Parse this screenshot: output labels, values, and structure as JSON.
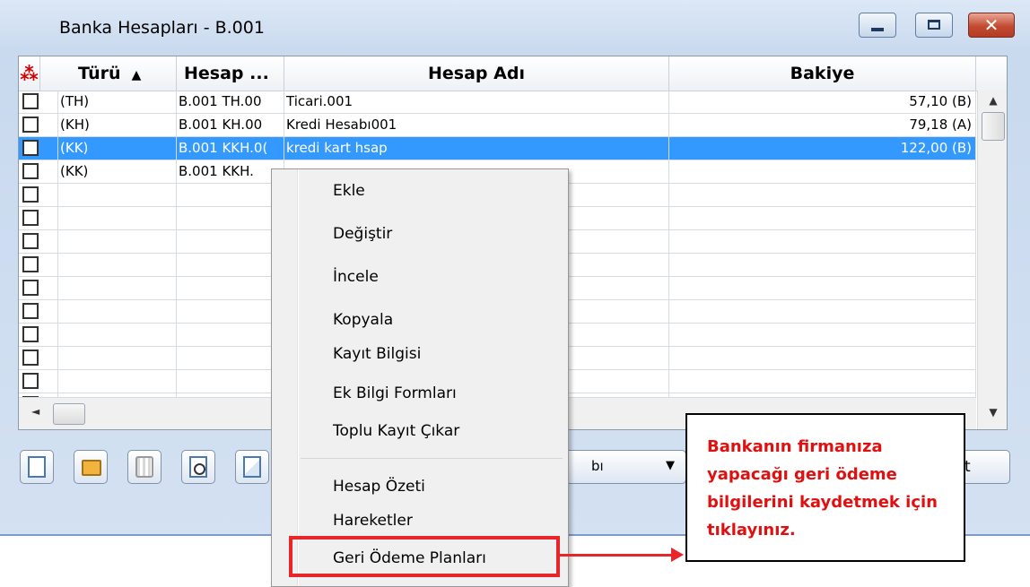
{
  "window": {
    "title": "Banka Hesapları - B.001",
    "controls": {
      "minimize": "minimize-icon",
      "maximize": "maximize-icon",
      "close": "✕"
    }
  },
  "grid": {
    "columns": [
      {
        "key": "select_all",
        "label": "⁂"
      },
      {
        "key": "turu",
        "label": "Türü",
        "sort": "▲"
      },
      {
        "key": "kod",
        "label": "Hesap ..."
      },
      {
        "key": "adi",
        "label": "Hesap Adı"
      },
      {
        "key": "bakiye",
        "label": "Bakiye"
      }
    ],
    "rows": [
      {
        "turu": "(TH)",
        "kod": "B.001 TH.00",
        "adi": "Ticari.001",
        "bakiye": "57,10 (B)",
        "selected": false
      },
      {
        "turu": "(KH)",
        "kod": "B.001 KH.00",
        "adi": "Kredi Hesabı001",
        "bakiye": "79,18 (A)",
        "selected": false
      },
      {
        "turu": "(KK)",
        "kod": "B.001 KKH.0(",
        "adi": "kredi kart hsap",
        "bakiye": "122,00 (B)",
        "selected": true
      },
      {
        "turu": "(KK)",
        "kod": "B.001 KKH.",
        "adi": "",
        "bakiye": "",
        "selected": false
      },
      {
        "turu": "",
        "kod": "",
        "adi": "",
        "bakiye": "",
        "selected": false
      },
      {
        "turu": "",
        "kod": "",
        "adi": "",
        "bakiye": "",
        "selected": false
      },
      {
        "turu": "",
        "kod": "",
        "adi": "",
        "bakiye": "",
        "selected": false
      },
      {
        "turu": "",
        "kod": "",
        "adi": "",
        "bakiye": "",
        "selected": false
      },
      {
        "turu": "",
        "kod": "",
        "adi": "",
        "bakiye": "",
        "selected": false
      },
      {
        "turu": "",
        "kod": "",
        "adi": "",
        "bakiye": "",
        "selected": false
      },
      {
        "turu": "",
        "kod": "",
        "adi": "",
        "bakiye": "",
        "selected": false
      },
      {
        "turu": "",
        "kod": "",
        "adi": "",
        "bakiye": "",
        "selected": false
      },
      {
        "turu": "",
        "kod": "",
        "adi": "",
        "bakiye": "",
        "selected": false
      },
      {
        "turu": "",
        "kod": "",
        "adi": "",
        "bakiye": "",
        "selected": false
      }
    ],
    "scroll": {
      "up": "▲",
      "down": "▼",
      "left": "◄"
    }
  },
  "toolbar": {
    "buttons": [
      "new-document-icon",
      "open-folder-icon",
      "delete-trash-icon",
      "preview-icon",
      "copy-icon"
    ],
    "dropdown_text": "bı",
    "dropdown_arrow": "▼",
    "right_button_text": "t"
  },
  "context_menu": {
    "items": [
      "Ekle",
      "Değiştir",
      "İncele",
      "Kopyala",
      "Kayıt Bilgisi",
      "Ek Bilgi Formları",
      "Toplu Kayıt Çıkar",
      "Hesap Özeti",
      "Hareketler",
      "Geri Ödeme Planları"
    ]
  },
  "annotation": {
    "text": "Bankanın firmanıza yapacağı geri ödeme bilgilerini kaydetmek için tıklayınız.",
    "color": "#e01010"
  },
  "colors": {
    "selection": "#3399ff",
    "highlight": "#e8262a"
  }
}
